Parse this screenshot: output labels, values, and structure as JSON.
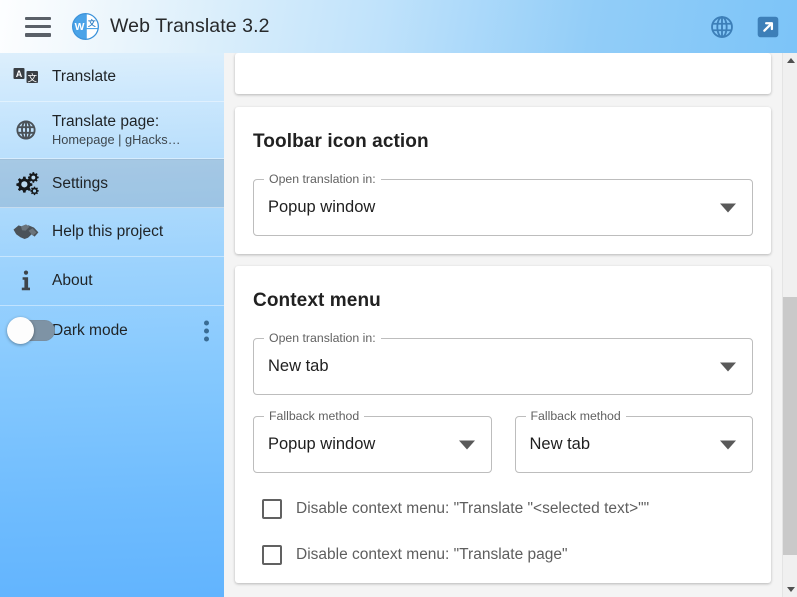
{
  "header": {
    "app_title": "Web Translate 3.2",
    "menu_icon": "hamburger-icon",
    "logo_icon": "web-translate-logo-icon",
    "language_icon": "globe-icon",
    "detach_icon": "open-in-new-window-icon",
    "accent": "#7cc4f8"
  },
  "sidebar": {
    "items": [
      {
        "label": "Translate",
        "sub": "",
        "icon": "translate-icon",
        "active": false
      },
      {
        "label": "Translate page:",
        "sub": "Homepage | gHacks…",
        "icon": "globe-icon",
        "active": false
      },
      {
        "label": "Settings",
        "sub": "",
        "icon": "gears-icon",
        "active": true
      },
      {
        "label": "Help this project",
        "sub": "",
        "icon": "handshake-icon",
        "active": false
      },
      {
        "label": "About",
        "sub": "",
        "icon": "info-icon",
        "active": false
      }
    ],
    "dark_mode": {
      "label": "Dark mode",
      "toggle_state": "off",
      "overflow_icon": "kebab-menu-icon"
    }
  },
  "main": {
    "sections": [
      {
        "title": "Toolbar icon action",
        "fields": [
          {
            "legend": "Open translation in:",
            "value": "Popup window",
            "caret": "chevron-down-icon"
          }
        ]
      },
      {
        "title": "Context menu",
        "fields": [
          {
            "legend": "Open translation in:",
            "value": "New tab",
            "caret": "chevron-down-icon"
          },
          {
            "legend": "Fallback method",
            "value": "Popup window",
            "caret": "chevron-down-icon"
          },
          {
            "legend": "Fallback method",
            "value": "New tab",
            "caret": "chevron-down-icon"
          }
        ],
        "checkboxes": [
          {
            "label": "Disable context menu: \"Translate \"<selected text>\"\"",
            "checked": false
          },
          {
            "label": "Disable context menu: \"Translate page\"",
            "checked": false
          }
        ]
      }
    ]
  },
  "scrollbar": {
    "up_icon": "scroll-up-arrow-icon",
    "down_icon": "scroll-down-arrow-icon",
    "thumb": "scrollbar-thumb"
  }
}
